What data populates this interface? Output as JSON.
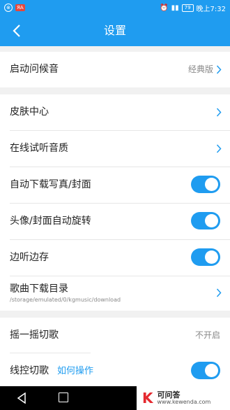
{
  "status_bar": {
    "time": "晚上7:32",
    "battery": "79",
    "app_badge": "ЯA"
  },
  "header": {
    "title": "设置"
  },
  "groups": [
    {
      "items": [
        {
          "label": "启动问候音",
          "value": "经典版",
          "type": "link"
        }
      ]
    },
    {
      "items": [
        {
          "label": "皮肤中心",
          "type": "link"
        },
        {
          "label": "在线试听音质",
          "type": "link"
        },
        {
          "label": "自动下载写真/封面",
          "type": "toggle",
          "checked": true
        },
        {
          "label": "头像/封面自动旋转",
          "type": "toggle",
          "checked": true
        },
        {
          "label": "边听边存",
          "type": "toggle",
          "checked": true
        },
        {
          "label": "歌曲下载目录",
          "sublabel": "/storage/emulated/0/kgmusic/download",
          "type": "link"
        }
      ]
    },
    {
      "items": [
        {
          "label": "摇一摇切歌",
          "value": "不开启",
          "type": "value"
        },
        {
          "label": "线控切歌",
          "link": "如何操作",
          "type": "toggle",
          "checked": true
        }
      ]
    }
  ],
  "watermark": {
    "logo": "K",
    "name": "可问答",
    "url": "www.kewenda.com"
  },
  "colors": {
    "accent": "#1f9cf0",
    "background": "#f1f1f1"
  }
}
